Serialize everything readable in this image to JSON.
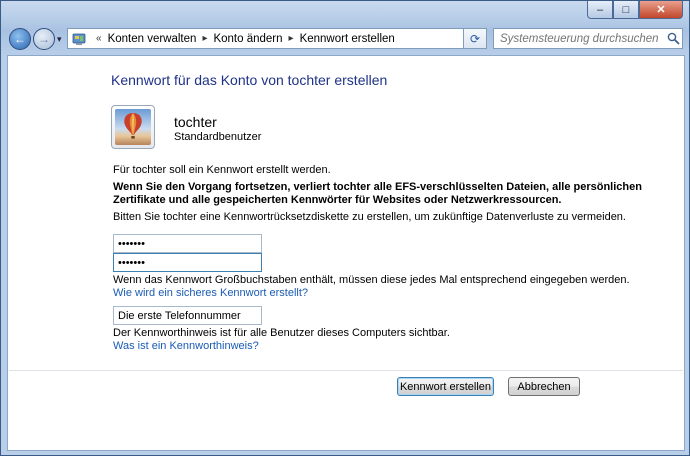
{
  "window": {
    "minimize_glyph": "–",
    "maximize_glyph": "□",
    "close_glyph": "✕"
  },
  "nav": {
    "back_glyph": "←",
    "forward_glyph": "→",
    "history_glyph": "▾",
    "breadcrumb_prefix": "«",
    "breadcrumbs": [
      "Konten verwalten",
      "Konto ändern",
      "Kennwort erstellen"
    ],
    "separator": "▸",
    "address_dropdown_glyph": "▾",
    "refresh_glyph": "⟳",
    "search_placeholder": "Systemsteuerung durchsuchen"
  },
  "page": {
    "title": "Kennwort für das Konto von tochter erstellen",
    "user_name": "tochter",
    "user_role": "Standardbenutzer",
    "intro": "Für tochter soll ein Kennwort erstellt werden.",
    "warning_line1": "Wenn Sie den Vorgang fortsetzen, verliert tochter alle EFS-verschlüsselten Dateien, alle persönlichen",
    "warning_line2": "Zertifikate und alle gespeicherten Kennwörter für Websites oder Netzwerkressourcen.",
    "reset_disk_hint": "Bitten Sie tochter eine Kennwortrücksetzdiskette zu erstellen, um zukünftige Datenverluste zu vermeiden.",
    "password_value": "•••••••",
    "confirm_value": "•••••••",
    "case_hint": "Wenn das Kennwort Großbuchstaben enthält, müssen diese jedes Mal entsprechend eingegeben werden.",
    "strong_password_link": "Wie wird ein sicheres Kennwort erstellt?",
    "hint_value": "Die erste Telefonnummer",
    "hint_visibility": "Der Kennworthinweis ist für alle Benutzer dieses Computers sichtbar.",
    "hint_help_link": "Was ist ein Kennworthinweis?"
  },
  "buttons": {
    "create": "Kennwort erstellen",
    "cancel": "Abbrechen"
  },
  "colors": {
    "title_blue": "#1e3287",
    "link_blue": "#1a5bb5",
    "focus_border": "#3c7fb1"
  }
}
